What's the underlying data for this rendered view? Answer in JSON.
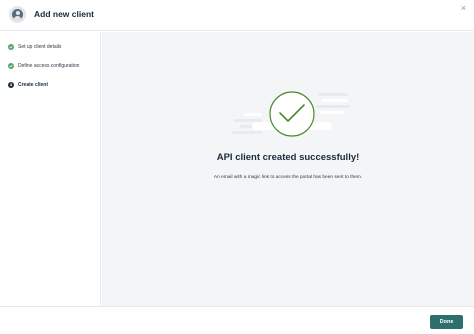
{
  "header": {
    "title": "Add new client",
    "avatar_icon": "user-icon",
    "close_icon": "close-icon",
    "close_glyph": "×"
  },
  "steps": [
    {
      "label": "Set up client details",
      "status": "done",
      "marker": ""
    },
    {
      "label": "Define access configuration",
      "status": "done",
      "marker": ""
    },
    {
      "label": "Create client",
      "status": "current",
      "marker": "3"
    }
  ],
  "main": {
    "illustration_icon": "checkmark-circle-icon",
    "title": "API client created successfully!",
    "subtitle": "An email with a magic link to access the portal has been sent to them."
  },
  "footer": {
    "done_label": "Done"
  },
  "colors": {
    "accent": "#2e6f6d",
    "success": "#57a46b",
    "check_green": "#4f8a2e"
  }
}
